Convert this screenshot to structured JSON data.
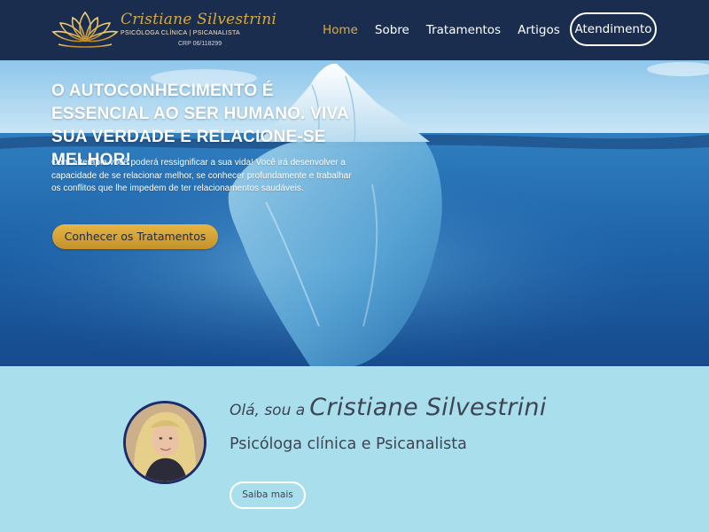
{
  "brand": {
    "name": "Cristiane Silvestrini",
    "subtitle": "PSICÓLOGA CLÍNICA | PSICANALISTA",
    "registration": "CRP 06/118299",
    "logo_icon": "lotus-icon"
  },
  "nav": {
    "items": [
      {
        "label": "Home",
        "active": true
      },
      {
        "label": "Sobre",
        "active": false
      },
      {
        "label": "Tratamentos",
        "active": false
      },
      {
        "label": "Artigos",
        "active": false
      }
    ],
    "cta_label": "Atendimento"
  },
  "hero": {
    "title": "O AUTOCONHECIMENTO É ESSENCIAL AO SER HUMANO. VIVA SUA VERDADE E RELACIONE-SE MELHOR!",
    "text": "Com a terapia você poderá ressignificar a sua vida! Você irá desenvolver a capacidade de se relacionar melhor, se conhecer profundamente e trabalhar os conflitos que lhe impedem de ter relacionamentos saudáveis.",
    "button_label": "Conhecer os Tratamentos",
    "background_icon": "iceberg-image"
  },
  "about": {
    "greeting_prefix": "Olá, sou a",
    "name": "Cristiane Silvestrini",
    "role": "Psicóloga clínica e Psicanalista",
    "button_label": "Saiba mais"
  },
  "colors": {
    "header_bg": "#1b2d4f",
    "accent_gold": "#d8ac44",
    "about_bg": "#a9dfec",
    "avatar_border": "#1d2c68"
  }
}
